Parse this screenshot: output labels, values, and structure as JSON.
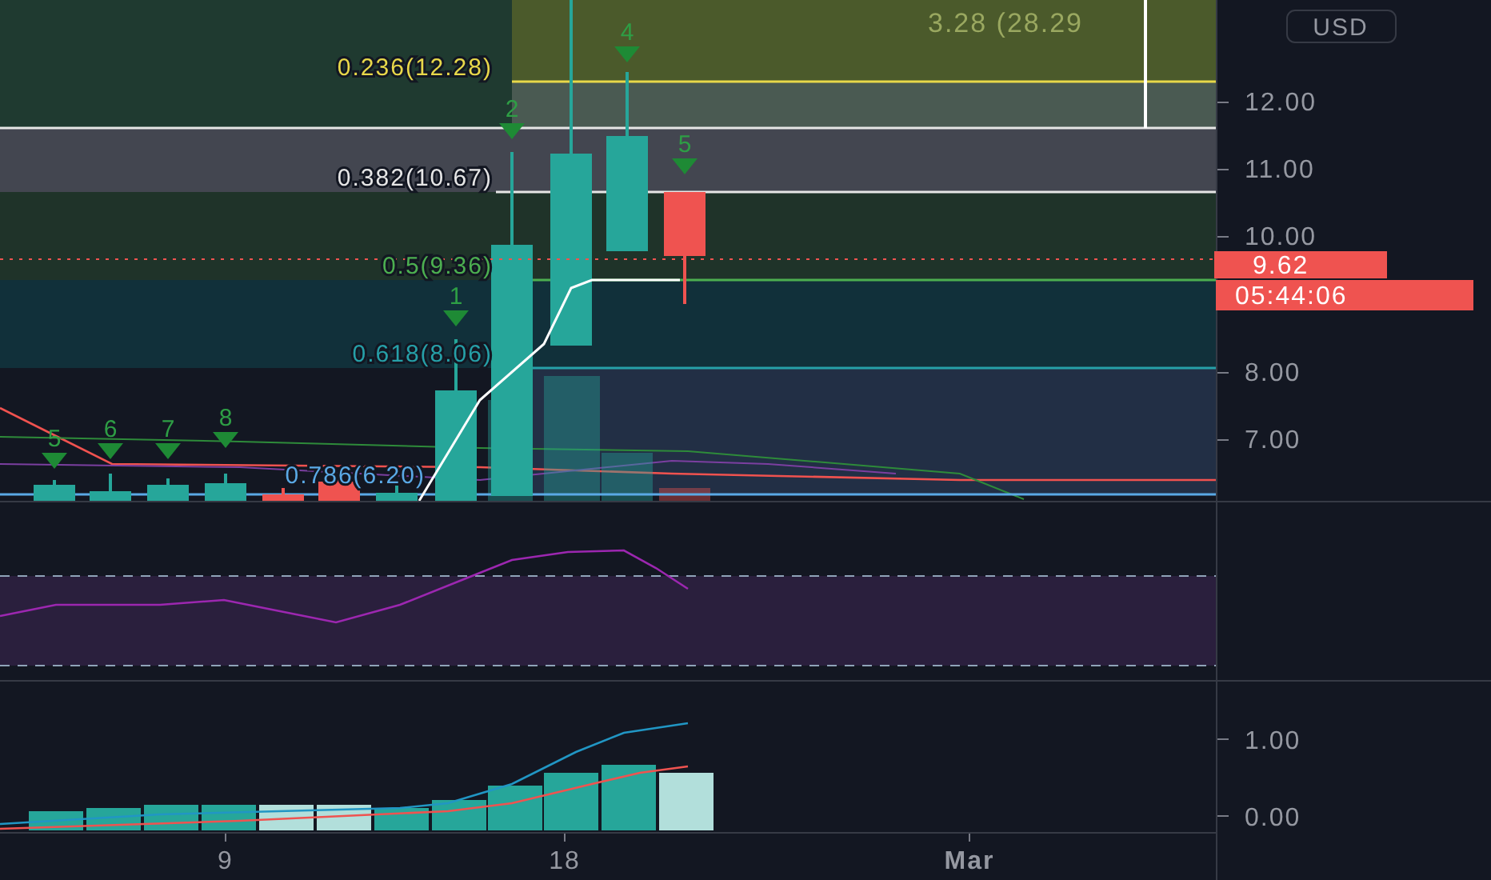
{
  "currency": "USD",
  "measure_label": "3.28 (28.29",
  "fib_levels": [
    {
      "label": "0.236(12.28)",
      "color": "#e8d84a"
    },
    {
      "label": "0.382(10.67)",
      "color": "#e6e6e6"
    },
    {
      "label": "0.5(9.36)",
      "color": "#4caf50"
    },
    {
      "label": "0.618(8.06)",
      "color": "#26a0a8"
    },
    {
      "label": "0.786(6.20)",
      "color": "#5aa9e6"
    }
  ],
  "price_axis": [
    "12.00",
    "11.00",
    "10.00",
    "8.00",
    "7.00"
  ],
  "last_price": "9.62",
  "countdown": "05:44:06",
  "markers": [
    "5",
    "6",
    "7",
    "8",
    "1",
    "2",
    "4",
    "5"
  ],
  "indicator_axis": [
    "1.00",
    "0.00"
  ],
  "time_axis": [
    "9",
    "18",
    "Mar"
  ]
}
